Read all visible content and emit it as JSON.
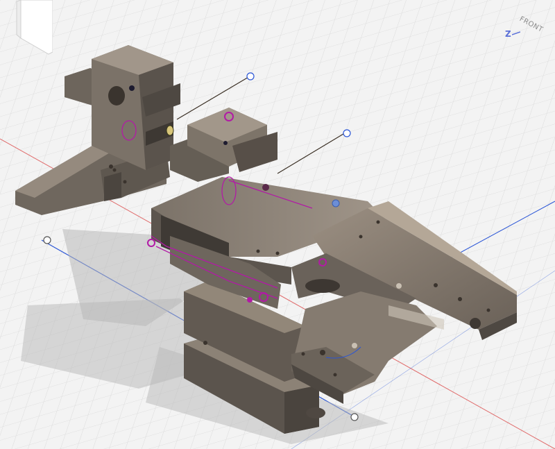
{
  "viewcube": {
    "face_label": "FRONT",
    "axis_label": "Z",
    "axis_color": "#5a6fd8"
  },
  "colors": {
    "background": "#f3f3f3",
    "grid": "#dcdcdc",
    "x_axis": "#e06a6a",
    "y_axis": "#2a55d6",
    "body_dark": "#5d564f",
    "body_mid": "#7a7167",
    "body_light": "#958b80",
    "sketch": "#b21aa6",
    "shadow": "#b8b8b8"
  },
  "model": {
    "name_icon": "3d-model-icon"
  }
}
